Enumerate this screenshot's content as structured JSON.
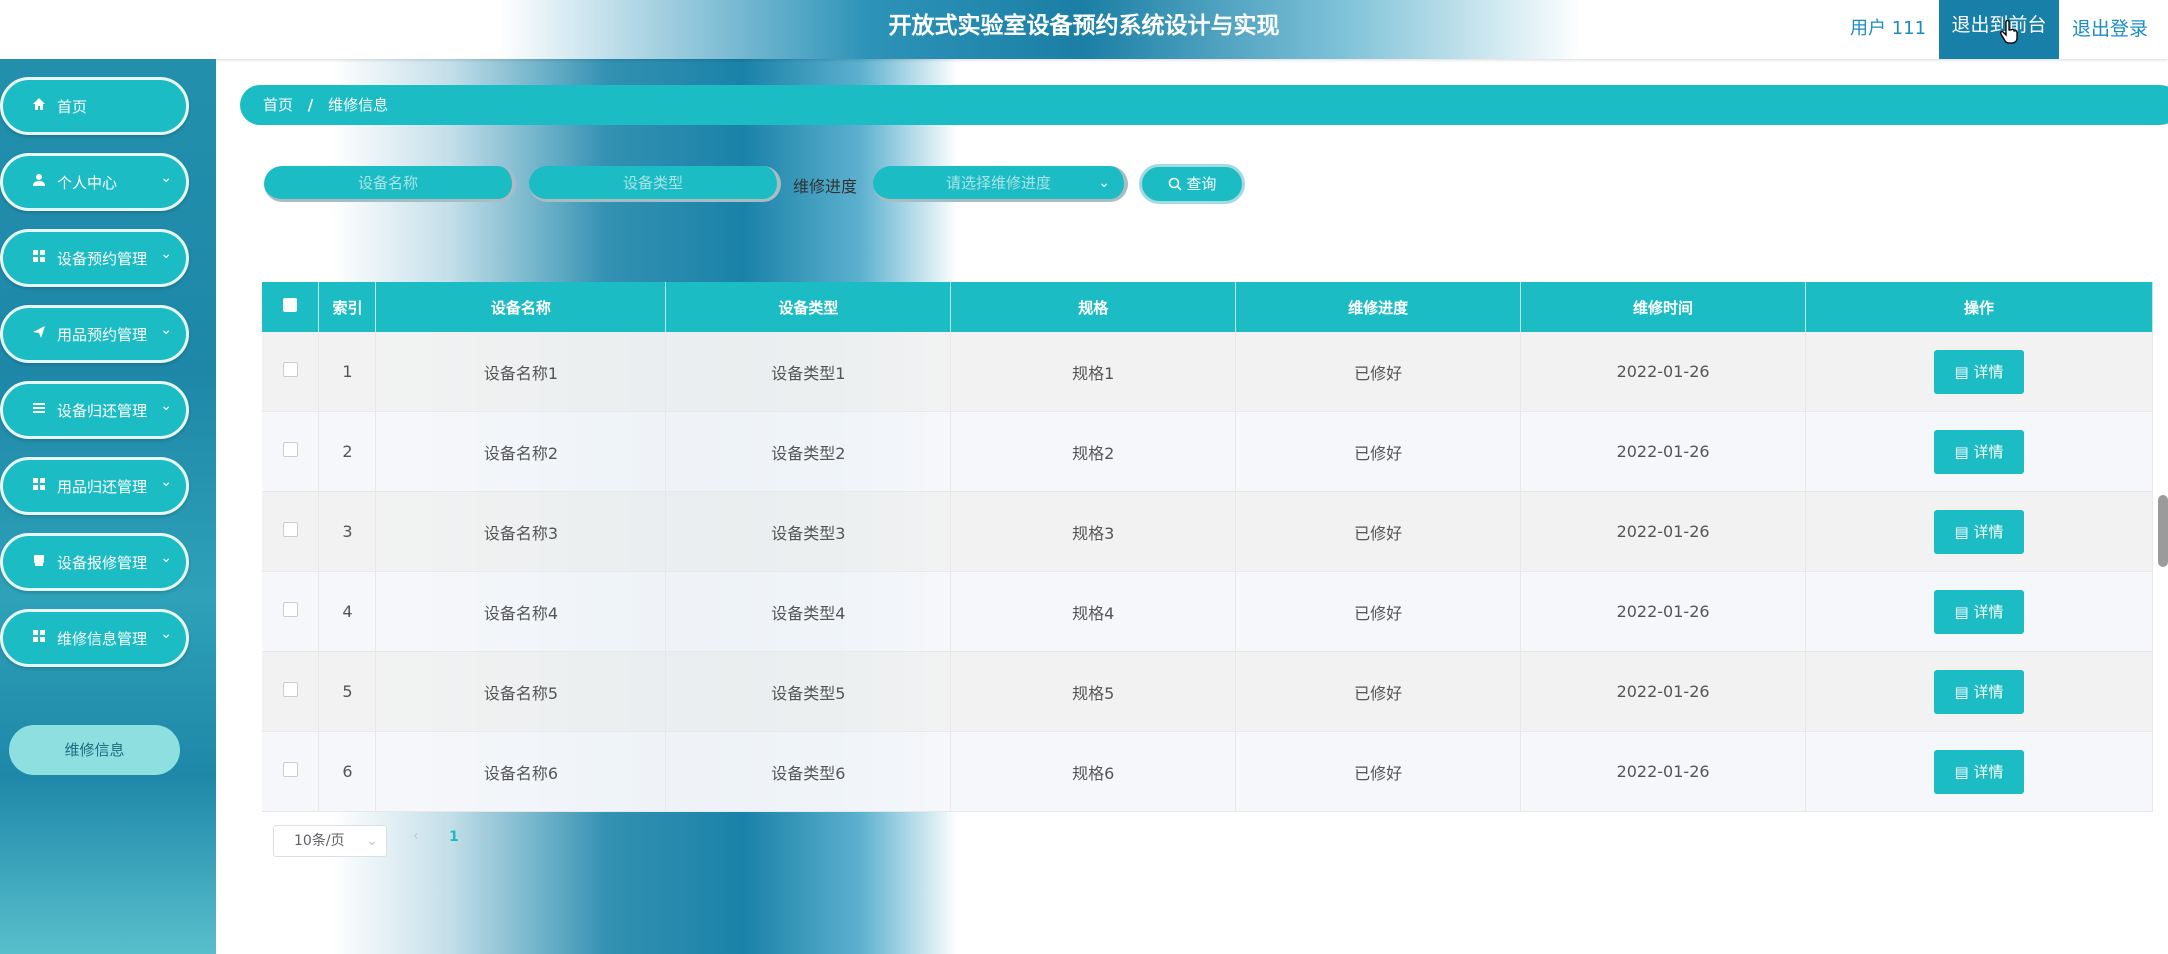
{
  "header": {
    "title": "开放式实验室设备预约系统设计与实现",
    "user": "用户 111",
    "backend_button": "退出到前台",
    "logout_button": "退出登录"
  },
  "sidebar": {
    "items": [
      {
        "label": "首页",
        "icon": "home-icon"
      },
      {
        "label": "个人中心",
        "icon": "user-icon"
      },
      {
        "label": "设备预约管理",
        "icon": "grid-icon"
      },
      {
        "label": "用品预约管理",
        "icon": "send-icon"
      },
      {
        "label": "设备归还管理",
        "icon": "list-icon"
      },
      {
        "label": "用品归还管理",
        "icon": "grid-icon"
      },
      {
        "label": "设备报修管理",
        "icon": "printer-icon"
      },
      {
        "label": "维修信息管理",
        "icon": "grid-icon"
      }
    ],
    "sub_item": "维修信息"
  },
  "breadcrumb": {
    "home": "首页",
    "separator": "/",
    "current": "维修信息"
  },
  "search": {
    "name_placeholder": "设备名称",
    "type_placeholder": "设备类型",
    "progress_label": "维修进度",
    "progress_placeholder": "请选择维修进度",
    "query_button": "查询"
  },
  "table": {
    "columns": [
      "索引",
      "设备名称",
      "设备类型",
      "规格",
      "维修进度",
      "维修时间",
      "操作"
    ],
    "rows": [
      {
        "index": "1",
        "name": "设备名称1",
        "type": "设备类型1",
        "spec": "规格1",
        "progress": "已修好",
        "time": "2022-01-26"
      },
      {
        "index": "2",
        "name": "设备名称2",
        "type": "设备类型2",
        "spec": "规格2",
        "progress": "已修好",
        "time": "2022-01-26"
      },
      {
        "index": "3",
        "name": "设备名称3",
        "type": "设备类型3",
        "spec": "规格3",
        "progress": "已修好",
        "time": "2022-01-26"
      },
      {
        "index": "4",
        "name": "设备名称4",
        "type": "设备类型4",
        "spec": "规格4",
        "progress": "已修好",
        "time": "2022-01-26"
      },
      {
        "index": "5",
        "name": "设备名称5",
        "type": "设备类型5",
        "spec": "规格5",
        "progress": "已修好",
        "time": "2022-01-26"
      },
      {
        "index": "6",
        "name": "设备名称6",
        "type": "设备类型6",
        "spec": "规格6",
        "progress": "已修好",
        "time": "2022-01-26"
      }
    ],
    "detail_button": "详情"
  },
  "pagination": {
    "page_size": "10条/页",
    "current_page": "1"
  },
  "colors": {
    "accent": "#1cbcc4",
    "header_dark": "#187fa8",
    "link": "#1a8ec4"
  }
}
